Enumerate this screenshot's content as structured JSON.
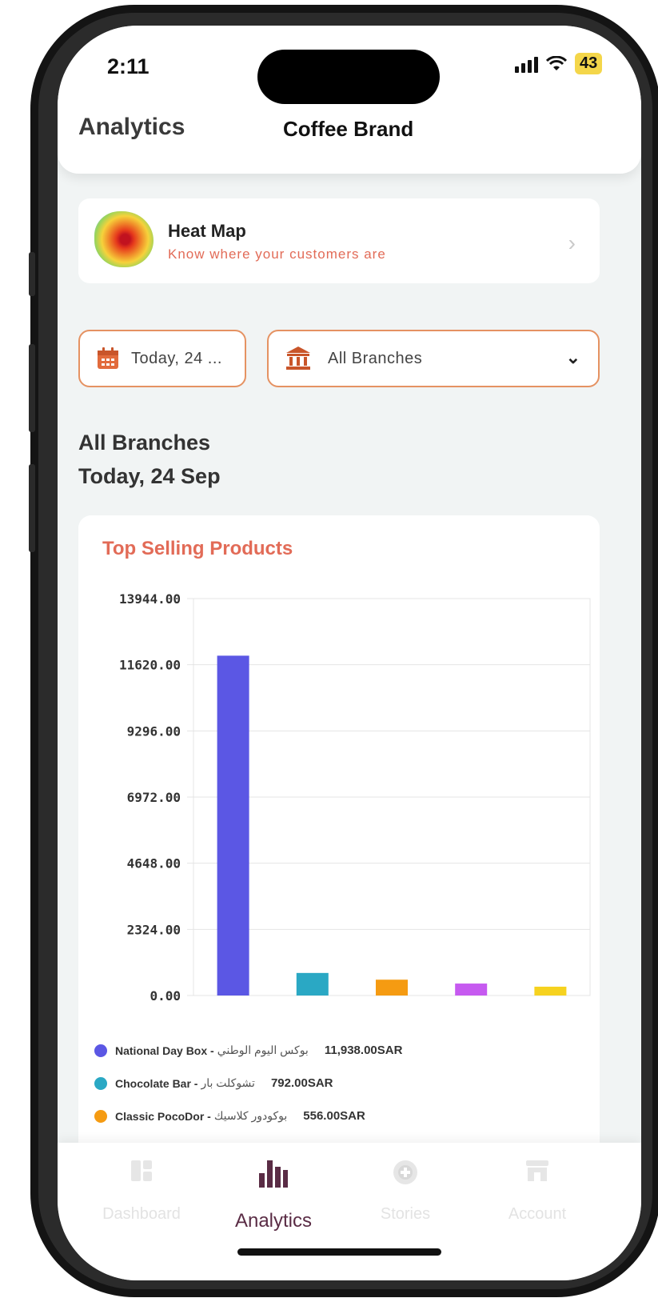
{
  "status_bar": {
    "time": "2:11",
    "battery": "43"
  },
  "header": {
    "title": "Analytics",
    "brand": "Coffee Brand"
  },
  "heat_map": {
    "title": "Heat Map",
    "subtitle": "Know where your customers are"
  },
  "filters": {
    "date_label": "Today, 24 ...",
    "branch_label": "All Branches"
  },
  "selection": {
    "branch": "All Branches",
    "date": "Today, 24 Sep"
  },
  "chart_card": {
    "title": "Top Selling Products"
  },
  "chart_data": {
    "type": "bar",
    "title": "Top Selling Products",
    "y_ticks": [
      "13944.00",
      "11620.00",
      "9296.00",
      "6972.00",
      "4648.00",
      "2324.00",
      "0.00"
    ],
    "ylim": [
      0,
      13944
    ],
    "grid": true,
    "values": [
      11938,
      792,
      556,
      420,
      310
    ],
    "colors": [
      "#5b57e4",
      "#2aa8c4",
      "#f59b12",
      "#c65af0",
      "#f6d21f"
    ]
  },
  "legend": [
    {
      "name": "National Day Box - ",
      "arabic": "بوكس اليوم الوطني",
      "value": "11,938.00SAR",
      "color": "#5b57e4"
    },
    {
      "name": "Chocolate Bar - ",
      "arabic": "تشوكلت بار",
      "value": "792.00SAR",
      "color": "#2aa8c4"
    },
    {
      "name": "Classic PocoDor - ",
      "arabic": "بوكودور كلاسيك",
      "value": "556.00SAR",
      "color": "#f59b12"
    }
  ],
  "tabs": [
    {
      "label": "Dashboard",
      "icon": "dashboard-icon",
      "active": false
    },
    {
      "label": "Analytics",
      "icon": "bar-chart-icon",
      "active": true
    },
    {
      "label": "Stories",
      "icon": "stories-icon",
      "active": false
    },
    {
      "label": "Account",
      "icon": "store-icon",
      "active": false
    }
  ],
  "colors": {
    "accent": "#e26b57",
    "border": "#e59262",
    "active_tab": "#5a2c45"
  }
}
